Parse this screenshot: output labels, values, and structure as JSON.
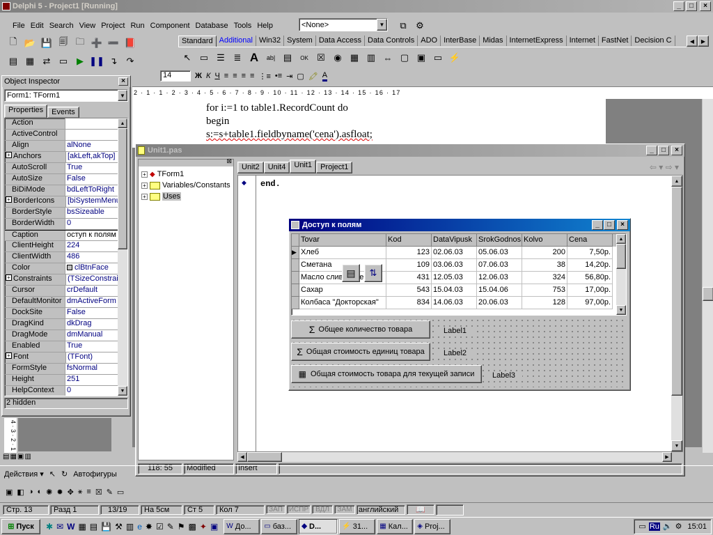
{
  "ide": {
    "title": "Delphi 5 - Project1 [Running]",
    "menu": [
      "File",
      "Edit",
      "Search",
      "View",
      "Project",
      "Run",
      "Component",
      "Database",
      "Tools",
      "Help"
    ],
    "config_combo": "<None>",
    "palette_tabs": [
      "Standard",
      "Additional",
      "Win32",
      "System",
      "Data Access",
      "Data Controls",
      "ADO",
      "InterBase",
      "Midas",
      "InternetExpress",
      "Internet",
      "FastNet",
      "Decision C"
    ]
  },
  "word_ruler": "2 · 1 · 1 · 2 · 3 · 4 · 5 · 6 · 7 · 8 · 9 · 10 · 11 · 12 · 13 · 14 · 15 · 16 · 17",
  "word_text": [
    "for i:=1 to table1.RecordCount do",
    "begin",
    "s:=s+table1.fieldbyname('cena').asfloat;"
  ],
  "inspector": {
    "title": "Object Inspector",
    "object": "Form1: TForm1",
    "tabs": [
      "Properties",
      "Events"
    ],
    "rows": [
      {
        "k": "Action",
        "v": ""
      },
      {
        "k": "ActiveControl",
        "v": ""
      },
      {
        "k": "Align",
        "v": "alNone"
      },
      {
        "k": "Anchors",
        "v": "[akLeft,akTop]",
        "plus": true
      },
      {
        "k": "AutoScroll",
        "v": "True"
      },
      {
        "k": "AutoSize",
        "v": "False"
      },
      {
        "k": "BiDiMode",
        "v": "bdLeftToRight"
      },
      {
        "k": "BorderIcons",
        "v": "[biSystemMenu,",
        "plus": true
      },
      {
        "k": "BorderStyle",
        "v": "bsSizeable"
      },
      {
        "k": "BorderWidth",
        "v": "0"
      },
      {
        "k": "Caption",
        "v": "оступ к полям",
        "sel": true
      },
      {
        "k": "ClientHeight",
        "v": "224"
      },
      {
        "k": "ClientWidth",
        "v": "486"
      },
      {
        "k": "Color",
        "v": "clBtnFace"
      },
      {
        "k": "Constraints",
        "v": "(TSizeConstrain",
        "plus": true
      },
      {
        "k": "Cursor",
        "v": "crDefault"
      },
      {
        "k": "DefaultMonitor",
        "v": "dmActiveForm"
      },
      {
        "k": "DockSite",
        "v": "False"
      },
      {
        "k": "DragKind",
        "v": "dkDrag"
      },
      {
        "k": "DragMode",
        "v": "dmManual"
      },
      {
        "k": "Enabled",
        "v": "True"
      },
      {
        "k": "Font",
        "v": "(TFont)",
        "plus": true
      },
      {
        "k": "FormStyle",
        "v": "fsNormal"
      },
      {
        "k": "Height",
        "v": "251"
      },
      {
        "k": "HelpContext",
        "v": "0"
      }
    ],
    "status": "2 hidden"
  },
  "editor": {
    "title": "Unit1.pas",
    "tree": [
      "TForm1",
      "Variables/Constants",
      "Uses"
    ],
    "tabs": [
      "Unit2",
      "Unit4",
      "Unit1",
      "Project1"
    ],
    "code": "end.",
    "status_pos": "118: 55",
    "status_mod": "Modified",
    "status_ins": "Insert"
  },
  "form": {
    "title": "Доступ к полям",
    "columns": [
      "Tovar",
      "Kod",
      "DataVipusk",
      "SrokGodnos",
      "Kolvo",
      "Cena"
    ],
    "rows": [
      [
        "Хлеб",
        "123",
        "02.06.03",
        "05.06.03",
        "200",
        "7,50р."
      ],
      [
        "Сметана",
        "109",
        "03.06.03",
        "07.06.03",
        "38",
        "14,20р."
      ],
      [
        "Масло сливочное",
        "431",
        "12.05.03",
        "12.06.03",
        "324",
        "56,80р."
      ],
      [
        "Сахар",
        "543",
        "15.04.03",
        "15.04.06",
        "753",
        "17,00р."
      ],
      [
        "Колбаса \"Докторская\"",
        "834",
        "14.06.03",
        "20.06.03",
        "128",
        "97,00р."
      ]
    ],
    "btn1": "Общее количество товара",
    "btn2": "Общая стоимость единиц товара",
    "btn3": "Общая стоимость товара для текущей записи",
    "label1": "Label1",
    "label2": "Label2",
    "label3": "Label3"
  },
  "word_draw": {
    "actions": "Действия",
    "autoshapes": "Автофигуры"
  },
  "word_status": {
    "page": "Стр. 13",
    "section": "Разд 1",
    "pages": "13/19",
    "at": "На 5см",
    "line": "Ст 5",
    "col": "Кол 7",
    "rec": "ЗАП",
    "trk": "ИСПР",
    "ext": "ВДЛ",
    "ovr": "ЗАМ",
    "lang": "английский"
  },
  "taskbar": {
    "start": "Пуск",
    "tasks": [
      "До...",
      "баз...",
      "D...",
      "31...",
      "Кал...",
      "Proj..."
    ],
    "lang": "Ru",
    "clock": "15:01"
  },
  "word_toolbar": {
    "style": "",
    "size": "14"
  },
  "left_ruler": "4 · 3 · 2 · 1"
}
